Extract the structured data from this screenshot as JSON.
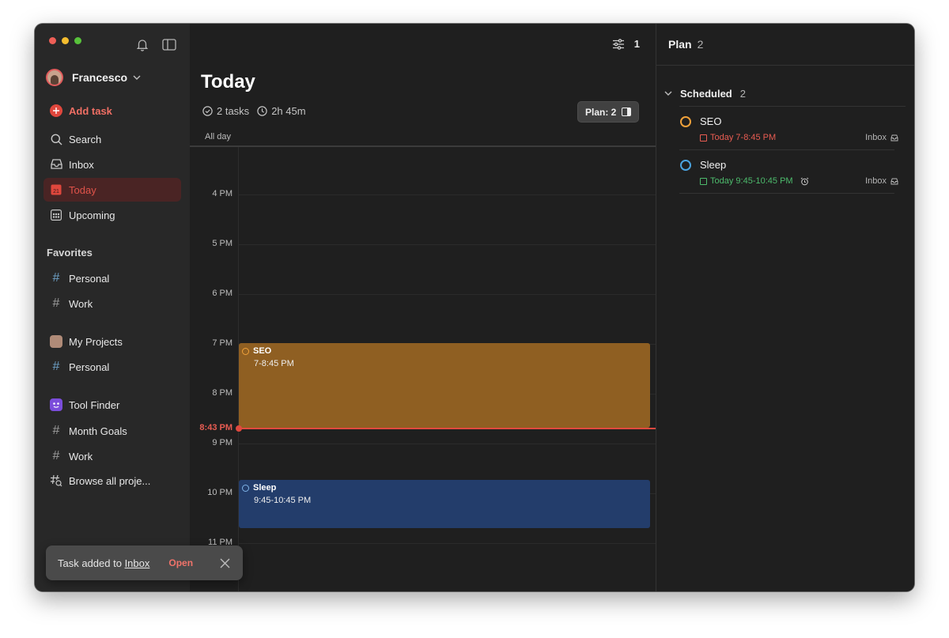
{
  "sidebar": {
    "user_name": "Francesco",
    "add_task_label": "Add task",
    "nav": [
      {
        "label": "Search"
      },
      {
        "label": "Inbox"
      },
      {
        "label": "Today",
        "badge": "21"
      },
      {
        "label": "Upcoming"
      }
    ],
    "favorites_title": "Favorites",
    "favorites": [
      {
        "label": "Personal"
      },
      {
        "label": "Work"
      }
    ],
    "my_projects": {
      "title": "My Projects",
      "items": [
        {
          "label": "Personal"
        }
      ]
    },
    "team": {
      "title": "Tool Finder",
      "items": [
        {
          "label": "Month Goals"
        },
        {
          "label": "Work"
        }
      ]
    },
    "browse_label": "Browse all proje..."
  },
  "toast": {
    "message_prefix": "Task added to ",
    "message_link": "Inbox",
    "action_label": "Open"
  },
  "main": {
    "filter_count": "1",
    "title": "Today",
    "tasks_count": "2 tasks",
    "duration": "2h 45m",
    "plan_button": "Plan: 2",
    "all_day_label": "All day",
    "hours": [
      "4 PM",
      "5 PM",
      "6 PM",
      "7 PM",
      "8 PM",
      "9 PM",
      "10 PM",
      "11 PM"
    ],
    "now_label": "8:43 PM",
    "events": [
      {
        "title": "SEO",
        "time": "7-8:45 PM",
        "color": "#8f5f22"
      },
      {
        "title": "Sleep",
        "time": "9:45-10:45 PM",
        "color": "#233d6b"
      }
    ]
  },
  "plan_panel": {
    "title": "Plan",
    "count": "2",
    "section_title": "Scheduled",
    "section_count": "2",
    "tasks": [
      {
        "name": "SEO",
        "due": "Today 7-8:45 PM",
        "project": "Inbox",
        "due_color": "#e85c52",
        "circle_color": "#f0a13a"
      },
      {
        "name": "Sleep",
        "due": "Today 9:45-10:45 PM",
        "project": "Inbox",
        "due_color": "#4dbb6c",
        "circle_color": "#4aa3df"
      }
    ]
  }
}
